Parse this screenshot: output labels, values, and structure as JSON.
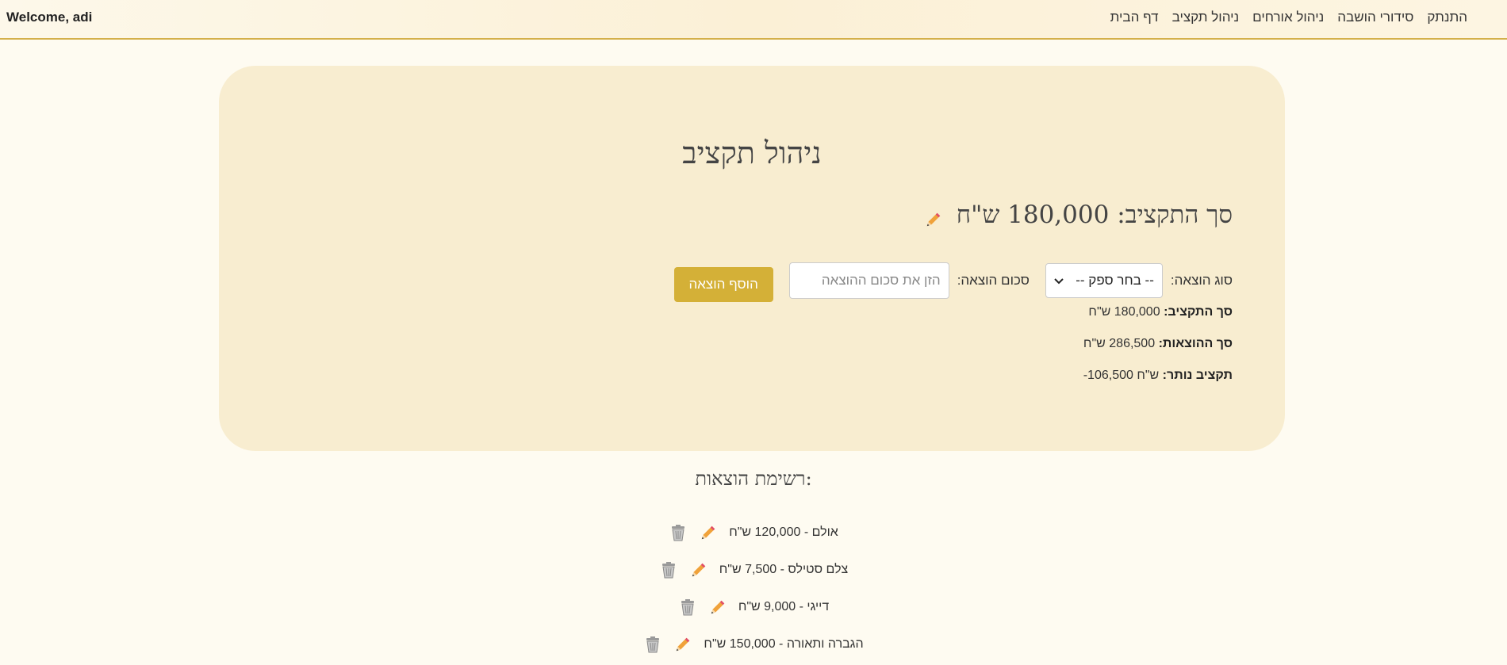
{
  "header": {
    "welcome": "Welcome, adi",
    "nav": [
      "דף הבית",
      "ניהול תקציב",
      "ניהול אורחים",
      "סידורי הושבה",
      "התנתק"
    ]
  },
  "page": {
    "title": "ניהול תקציב",
    "budget_heading": "סך התקציב: 180,000 ש\"ח"
  },
  "form": {
    "type_label": "סוג הוצאה:",
    "select_value": "-- בחר ספק --",
    "amount_label": "סכום הוצאה:",
    "amount_placeholder": "הזן את סכום ההוצאה",
    "add_button": "הוסף הוצאה"
  },
  "summary": {
    "budget_label": "סך התקציב:",
    "budget_value": "180,000 ש\"ח",
    "expenses_label": "סך ההוצאות:",
    "expenses_value": "286,500 ש\"ח",
    "remaining_label": "תקציב נותר:",
    "remaining_value": "-106,500 ש\"ח"
  },
  "expenses": {
    "title": "רשימת הוצאות:",
    "items": [
      "אולם - 120,000 ש\"ח",
      "צלם סטילס - 7,500 ש\"ח",
      "דייגי - 9,000 ש\"ח",
      "הגברה ותאורה - 150,000 ש\"ח"
    ]
  },
  "colors": {
    "accent": "#d4b037",
    "card": "#f8edd0",
    "background": "#fefbf1"
  },
  "icons": [
    "pencil-icon",
    "trash-icon",
    "chevron-down-icon"
  ]
}
